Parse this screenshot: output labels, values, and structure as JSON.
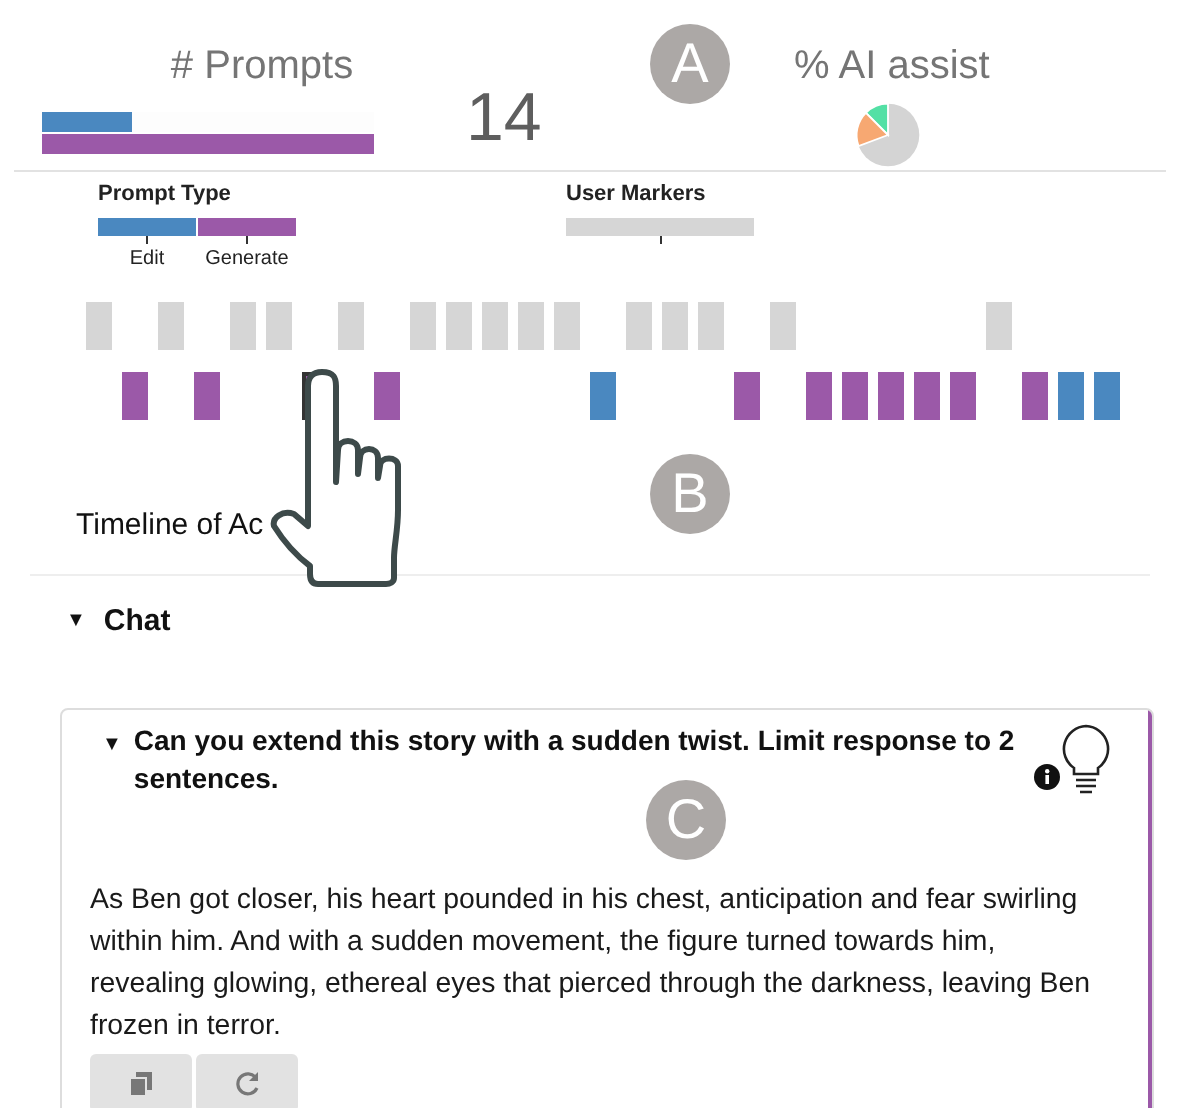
{
  "summary": {
    "prompts_title": "# Prompts",
    "prompt_bars": [
      {
        "kind": "edit",
        "level": 0.27
      },
      {
        "kind": "generate",
        "level": 1
      }
    ],
    "prompt_count": "14",
    "ai_title": "% AI assist"
  },
  "annotations": [
    "A",
    "B",
    "C"
  ],
  "legend": {
    "prompt_type": {
      "title": "Prompt Type",
      "items": [
        {
          "kind": "edit",
          "label": "Edit"
        },
        {
          "kind": "generate",
          "label": "Generate"
        }
      ]
    },
    "user_markers": {
      "title": "User Markers"
    }
  },
  "timeline": {
    "slots": [
      {
        "kind": "marker"
      },
      {
        "kind": "generate",
        "selected": false
      },
      {
        "kind": "marker"
      },
      {
        "kind": "generate",
        "selected": false
      },
      {
        "kind": "marker"
      },
      {
        "kind": "marker"
      },
      {
        "kind": "generate",
        "selected": true
      },
      {
        "kind": "marker"
      },
      {
        "kind": "generate",
        "selected": false
      },
      {
        "kind": "marker"
      },
      {
        "kind": "marker"
      },
      {
        "kind": "marker"
      },
      {
        "kind": "marker"
      },
      {
        "kind": "marker"
      },
      {
        "kind": "edit",
        "selected": false
      },
      {
        "kind": "marker"
      },
      {
        "kind": "marker"
      },
      {
        "kind": "marker"
      },
      {
        "kind": "generate",
        "selected": false
      },
      {
        "kind": "marker"
      },
      {
        "kind": "generate",
        "selected": false
      },
      {
        "kind": "generate",
        "selected": false
      },
      {
        "kind": "generate",
        "selected": false
      },
      {
        "kind": "generate",
        "selected": false
      },
      {
        "kind": "generate",
        "selected": false
      },
      {
        "kind": "marker"
      },
      {
        "kind": "generate",
        "selected": false
      },
      {
        "kind": "edit",
        "selected": false
      },
      {
        "kind": "edit",
        "selected": false
      }
    ],
    "caption": "Timeline of Ac"
  },
  "chat": {
    "caret": "▼",
    "title": "Chat",
    "expanded": true,
    "card": {
      "kind": "generate",
      "caret": "▼",
      "expanded": true,
      "prompt": "Can you extend this story with a sudden twist. Limit response to 2 sentences.",
      "response": "As Ben got closer, his heart pounded in his chest, anticipation and fear swirling within him. And with a sudden movement, the figure turned towards him, revealing glowing, ethereal eyes that pierced through the darkness, leaving Ben frozen in terror."
    }
  }
}
